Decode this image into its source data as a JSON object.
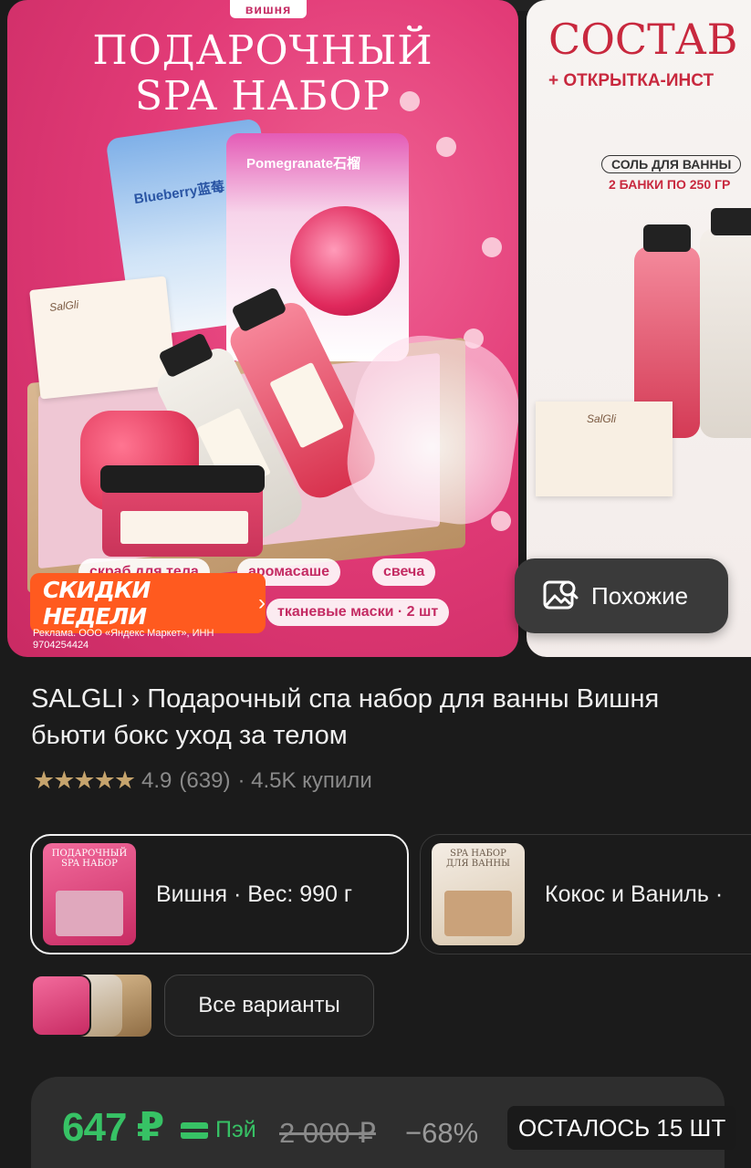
{
  "gallery": {
    "main_slide": {
      "variant_tag": "вишня",
      "title_line1": "ПОДАРОЧНЫЙ",
      "title_line2": "SPA НАБОР",
      "mask_blue_label": "Blueberry蓝莓",
      "mask_pink_label": "Pomegranate石榴",
      "card_brand": "SalGli",
      "chips": [
        "скраб для тела",
        "аромасаше",
        "свеча",
        "тканевые маски · 2 шт"
      ],
      "promo_label": "СКИДКИ НЕДЕЛИ",
      "ad_info": "Реклама. ООО «Яндекс Маркет», ИНН 9704254424"
    },
    "side_slide": {
      "title": "СОСТАВ Н",
      "subtitle": "+ ОТКРЫТКА-ИНСТ",
      "pill": "СОЛЬ ДЛЯ ВАННЫ",
      "pill_sub": "2 БАНКИ ПО 250 ГР",
      "card_brand": "SalGli"
    },
    "similar_button": "Похожие"
  },
  "product": {
    "brand": "SALGLI",
    "title": "Подарочный спа набор для ванны Вишня бьюти бокс уход за телом",
    "rating": "4.9",
    "reviews": "(639)",
    "bought": "· 4.5K купили",
    "stars": 5
  },
  "variants": [
    {
      "label": "Вишня · Вес: 990 г",
      "thumb_text": "ПОДАРОЧНЫЙ SPA НАБОР",
      "selected": true
    },
    {
      "label": "Кокос и Ваниль ·",
      "thumb_text": "SPA НАБОР ДЛЯ ВАННЫ",
      "selected": false
    }
  ],
  "all_variants_label": "Все варианты",
  "price": {
    "current": "647 ₽",
    "pay_label": "Пэй",
    "old": "2 000 ₽",
    "discount": "−68%",
    "stock": "ОСТАЛОСЬ 15 ШТ"
  },
  "colors": {
    "background": "#1b1b1b",
    "price_green": "#37c265",
    "promo_orange": "#ff5a1f",
    "brand_pink": "#e23b77",
    "star_gold": "#c6a46d"
  }
}
